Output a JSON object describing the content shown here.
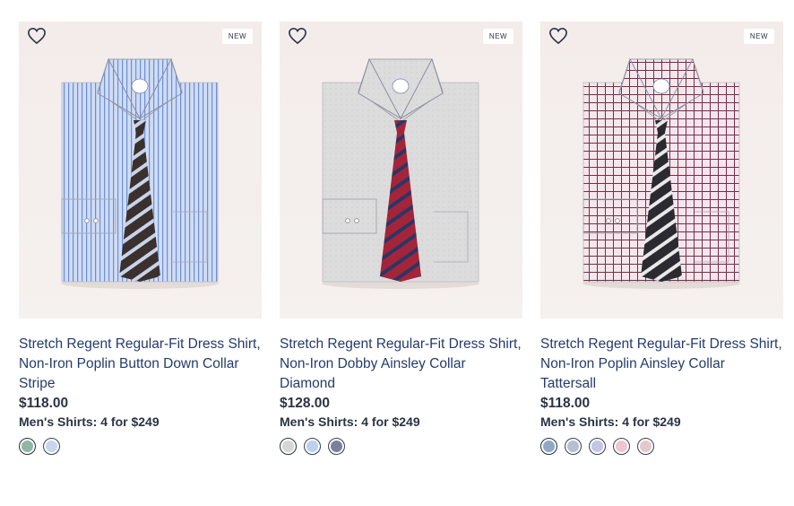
{
  "products": [
    {
      "badge": "NEW",
      "title": "Stretch Regent Regular-Fit Dress Shirt, Non-Iron Poplin Button Down Collar Stripe",
      "price": "$118.00",
      "promo": "Men's Shirts: 4 for $249",
      "shirt_color": "#cfdcf3",
      "shirt_pattern": "stripe",
      "tie_base": "#3a302e",
      "tie_stripe": "#c9d3e8",
      "swatches": [
        {
          "name": "green-stripe",
          "color": "#8fb8a4"
        },
        {
          "name": "blue-stripe",
          "color": "#c7d5ef"
        }
      ]
    },
    {
      "badge": "NEW",
      "title": "Stretch Regent Regular-Fit Dress Shirt, Non-Iron Dobby Ainsley Collar Diamond",
      "price": "$128.00",
      "promo": "Men's Shirts: 4 for $249",
      "shirt_color": "#dcdcdc",
      "shirt_pattern": "solid",
      "tie_base": "#a3253a",
      "tie_stripe": "#2c3566",
      "swatches": [
        {
          "name": "grey",
          "color": "#d6d6d6"
        },
        {
          "name": "light-blue",
          "color": "#bcd0f1"
        },
        {
          "name": "navy-grey",
          "color": "#7a809b"
        }
      ]
    },
    {
      "badge": "NEW",
      "title": "Stretch Regent Regular-Fit Dress Shirt, Non-Iron Poplin Ainsley Collar Tattersall",
      "price": "$118.00",
      "promo": "Men's Shirts: 4 for $249",
      "shirt_color": "#f4e7ec",
      "shirt_pattern": "check",
      "tie_base": "#2a2a30",
      "tie_stripe": "#e8e8ea",
      "swatches": [
        {
          "name": "blue-check",
          "color": "#8fa8c7"
        },
        {
          "name": "grey-check",
          "color": "#b8bfd0"
        },
        {
          "name": "lavender-check",
          "color": "#c3c4e6"
        },
        {
          "name": "pink-check",
          "color": "#efc6d0"
        },
        {
          "name": "red-check",
          "color": "#e3c8cc"
        }
      ]
    }
  ]
}
